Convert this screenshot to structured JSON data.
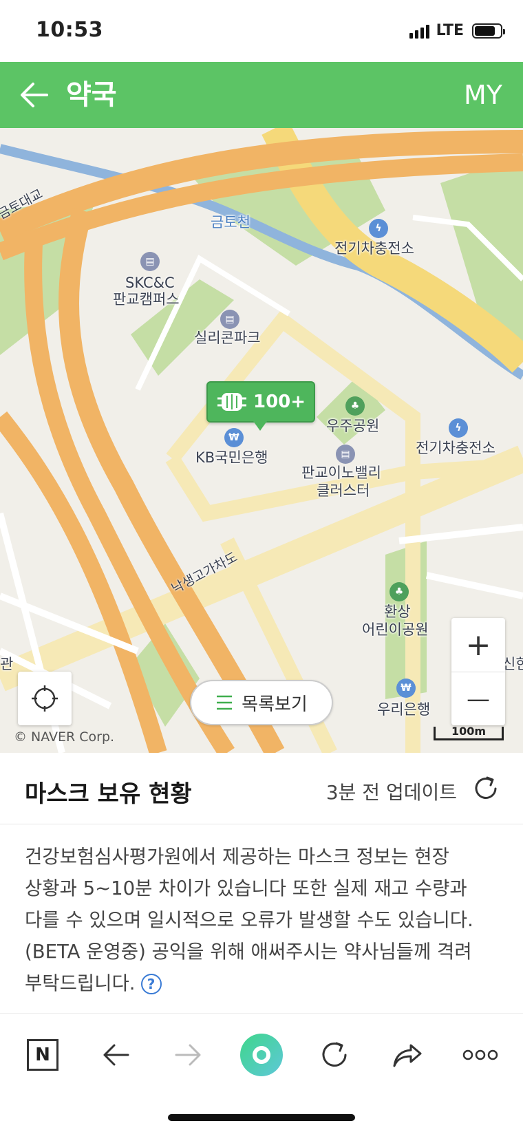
{
  "status_bar": {
    "time": "10:53",
    "network": "LTE",
    "battery_level": 0.8
  },
  "header": {
    "title": "약국",
    "my_label": "MY",
    "color": "#5cc465"
  },
  "map": {
    "water_labels": {
      "stream": "금토천"
    },
    "road_labels": {
      "bridge": "금토대교",
      "overpass": "낙생고가차도"
    },
    "poi": {
      "skcc_line1": "SKC&C",
      "skcc_line2": "판교캠퍼스",
      "silicon_park": "실리콘파크",
      "ev_station_1": "전기차충전소",
      "ev_station_2": "전기차충전소",
      "space_park": "우주공원",
      "kb_bank": "KB국민은행",
      "innovalley_line1": "판교이노밸리",
      "innovalley_line2": "클러스터",
      "kids_park_line1": "환상",
      "kids_park_line2": "어린이공원",
      "woori_bank": "우리은행",
      "left_edge": "관",
      "right_edge": "신한"
    },
    "mask_marker": {
      "count": "100+",
      "icon": "mask-icon"
    },
    "list_button_label": "목록보기",
    "copyright": "© NAVER Corp.",
    "scale_label": "100m",
    "zoom_in": "+",
    "zoom_out": "—"
  },
  "mask_status": {
    "title": "마스크 보유 현황",
    "update_text": "3분 전 업데이트"
  },
  "notice": {
    "text": "건강보험심사평가원에서 제공하는 마스크 정보는 현장 상황과 5~10분 차이가 있습니다 또한 실제 재고 수량과 다를 수 있으며 일시적으로 오류가 발생할 수도 있습니다.(BETA 운영중) 공익을 위해 애써주시는 약사님들께 격려 부탁드립니다.",
    "help_symbol": "?"
  },
  "bottom_nav": {
    "naver_logo": "N",
    "items": [
      "naver-home-icon",
      "back-icon",
      "forward-icon",
      "green-dot-icon",
      "reload-icon",
      "share-icon",
      "more-icon"
    ]
  }
}
